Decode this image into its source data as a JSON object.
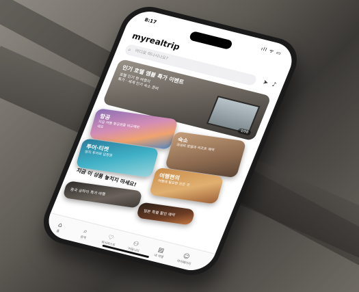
{
  "status": {
    "time": "8:17",
    "signal": "ıll ᯤ ▭"
  },
  "brand": {
    "logo": "myrealtrip"
  },
  "search": {
    "placeholder": "어디로 떠나시나요?"
  },
  "banner": {
    "title": "인기 호텔 엠블 특가 이벤트",
    "line1": "호텔 인기 현 여행지",
    "line2": "특가 · 세계 인기 숙소 준비",
    "page": "1/10"
  },
  "categories": [
    {
      "label": "항공",
      "sub": "지금 여행 항공권을 비교해보세요"
    },
    {
      "label": "숙소",
      "sub": "국내외 호텔과 리조트 예약"
    },
    {
      "label": "투어·티켓",
      "sub": "현지 투어와 입장권"
    },
    {
      "label": "여행편의",
      "sub": "여행에 필요한 모든 것"
    }
  ],
  "section_title": "지금 이 상품 놓치지 마세요!",
  "deals": [
    {
      "label": "중국 상하이 특가 여행"
    },
    {
      "label": "일본 특별 할인 예약"
    }
  ],
  "tabs": [
    {
      "label": "홈",
      "icon": "⌂"
    },
    {
      "label": "검색",
      "icon": "⌕"
    },
    {
      "label": "위시리스트",
      "icon": "♡"
    },
    {
      "label": "커뮤니티",
      "icon": "⚇"
    },
    {
      "label": "내 여행",
      "icon": "▤"
    },
    {
      "label": "마이페이지",
      "icon": "☺"
    }
  ]
}
